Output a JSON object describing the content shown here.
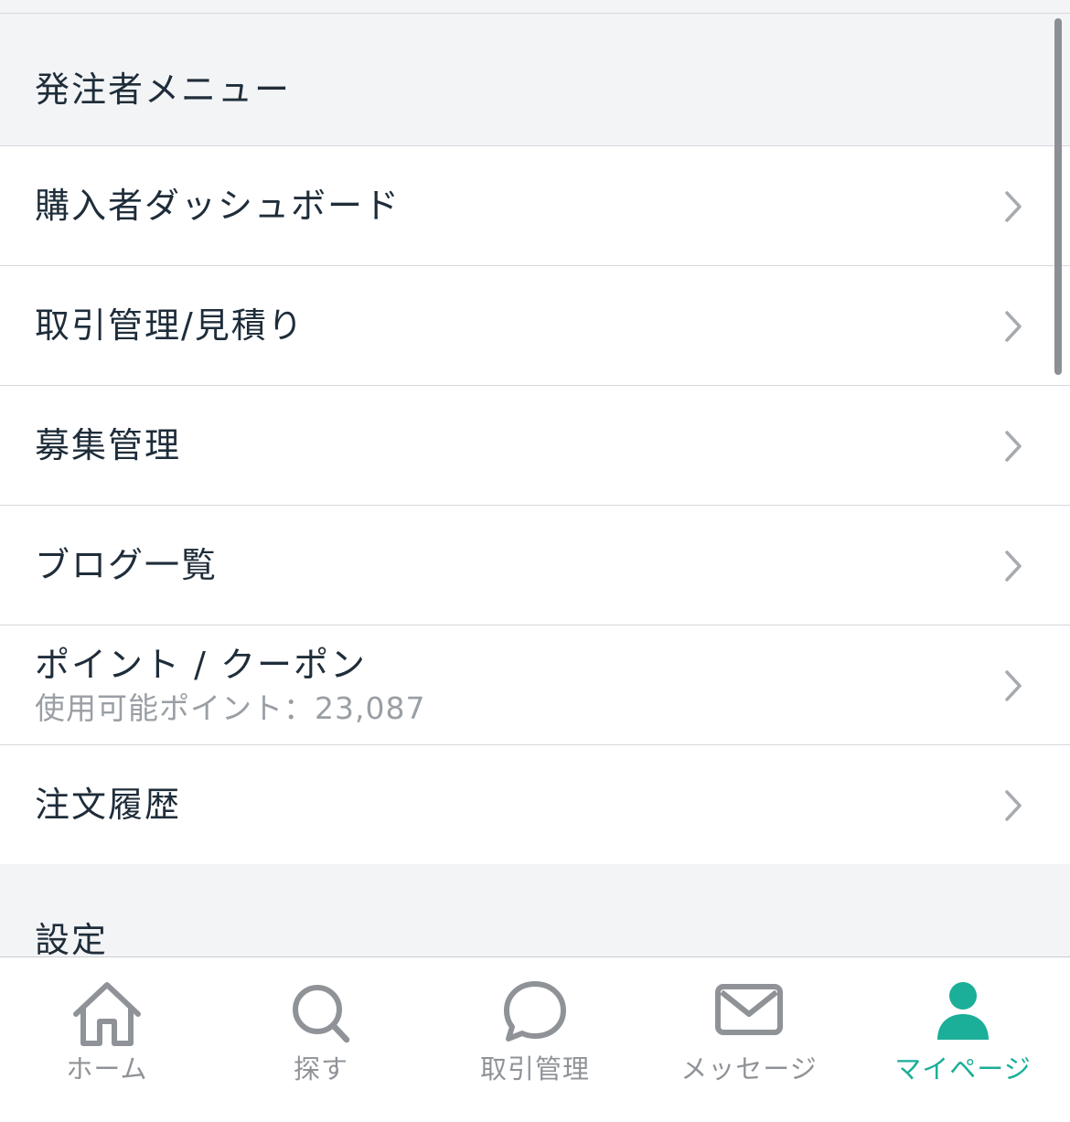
{
  "colors": {
    "accent": "#1bae98",
    "inactive_tab": "#8f9397",
    "section_bg": "#f3f4f6",
    "divider": "#d6d8db",
    "text": "#1f2d3a",
    "subtext": "#9a9fa5"
  },
  "sections": {
    "orderer_menu": {
      "title": "発注者メニュー",
      "items": [
        {
          "label": "購入者ダッシュボード",
          "icon": "chevron-right-icon"
        },
        {
          "label": "取引管理/見積り",
          "icon": "chevron-right-icon"
        },
        {
          "label": "募集管理",
          "icon": "chevron-right-icon"
        },
        {
          "label": "ブログ一覧",
          "icon": "chevron-right-icon"
        },
        {
          "label": "ポイント / クーポン",
          "sublabel": "使用可能ポイント：23,087",
          "icon": "chevron-right-icon"
        },
        {
          "label": "注文履歴",
          "icon": "chevron-right-icon"
        }
      ]
    },
    "settings": {
      "title": "設定"
    }
  },
  "tabbar": {
    "tabs": [
      {
        "label": "ホーム",
        "icon": "home-icon",
        "active": false
      },
      {
        "label": "探す",
        "icon": "search-icon",
        "active": false
      },
      {
        "label": "取引管理",
        "icon": "chat-bubble-icon",
        "active": false
      },
      {
        "label": "メッセージ",
        "icon": "mail-icon",
        "active": false
      },
      {
        "label": "マイページ",
        "icon": "person-icon",
        "active": true
      }
    ]
  }
}
